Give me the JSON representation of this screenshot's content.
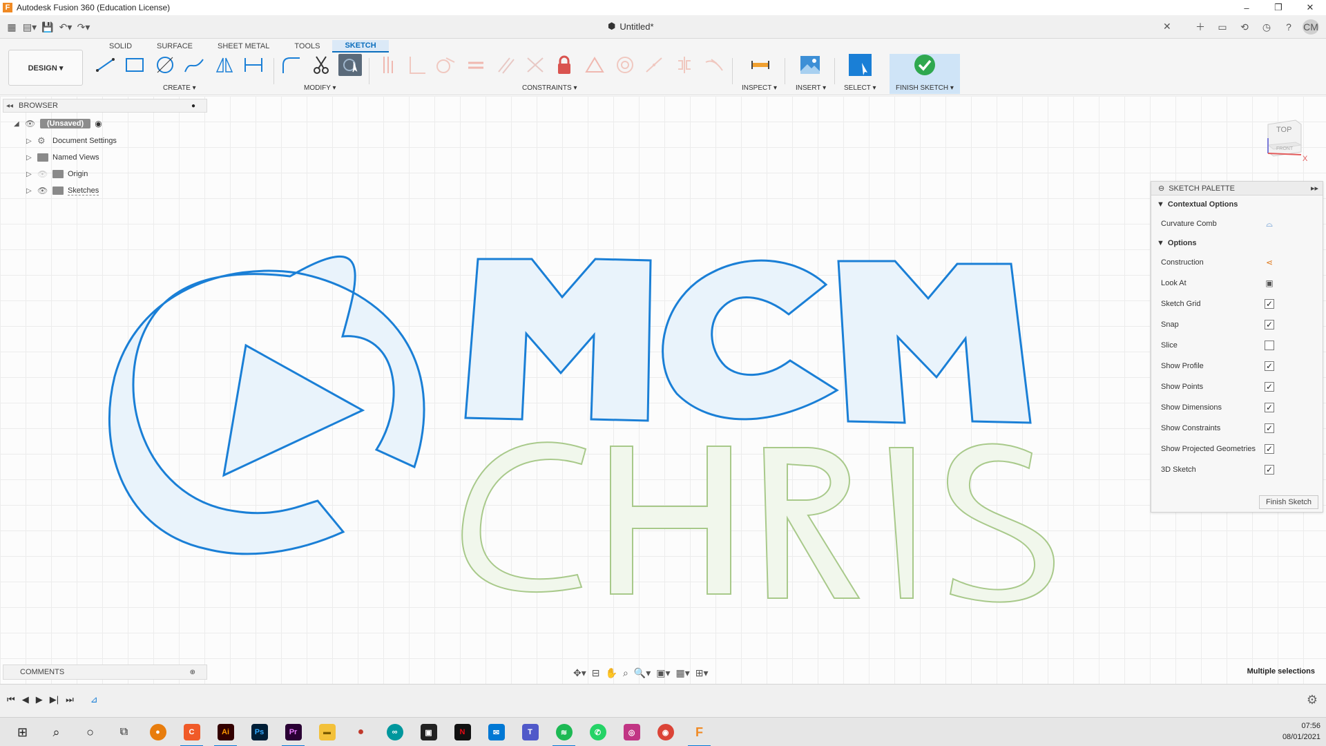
{
  "window": {
    "title": "Autodesk Fusion 360 (Education License)",
    "app_icon_letter": "F",
    "minimize": "–",
    "restore": "❐",
    "close": "✕"
  },
  "document": {
    "tab_title": "Untitled*",
    "close": "✕",
    "avatar": "CM"
  },
  "ribbon": {
    "workspace": "DESIGN ▾",
    "tabs": [
      "SOLID",
      "SURFACE",
      "SHEET METAL",
      "TOOLS",
      "SKETCH"
    ],
    "active_tab": "SKETCH",
    "groups": {
      "create": "CREATE ▾",
      "modify": "MODIFY ▾",
      "constraints": "CONSTRAINTS ▾",
      "inspect": "INSPECT ▾",
      "insert": "INSERT ▾",
      "select": "SELECT ▾",
      "finish": "FINISH SKETCH ▾"
    }
  },
  "browser": {
    "title": "BROWSER",
    "root": "(Unsaved)",
    "items": [
      "Document Settings",
      "Named Views",
      "Origin",
      "Sketches"
    ]
  },
  "viewcube": {
    "top": "TOP",
    "front": "FRONT",
    "axis_x": "X"
  },
  "palette": {
    "title": "SKETCH PALETTE",
    "contextual_section": "Contextual Options",
    "curvature_comb": "Curvature Comb",
    "options_section": "Options",
    "options": [
      {
        "label": "Construction",
        "type": "icon"
      },
      {
        "label": "Look At",
        "type": "icon"
      },
      {
        "label": "Sketch Grid",
        "checked": true
      },
      {
        "label": "Snap",
        "checked": true
      },
      {
        "label": "Slice",
        "checked": false
      },
      {
        "label": "Show Profile",
        "checked": true
      },
      {
        "label": "Show Points",
        "checked": true
      },
      {
        "label": "Show Dimensions",
        "checked": true
      },
      {
        "label": "Show Constraints",
        "checked": true
      },
      {
        "label": "Show Projected Geometries",
        "checked": true
      },
      {
        "label": "3D Sketch",
        "checked": true
      }
    ],
    "finish_button": "Finish Sketch"
  },
  "comments": {
    "label": "COMMENTS"
  },
  "status": {
    "selection": "Multiple selections"
  },
  "sketch_text": {
    "line1": "MCM",
    "line2": "CHRIS"
  },
  "colors": {
    "accent": "#0a6ebd",
    "sketch_blue": "#1a7fd6",
    "sketch_green": "#a8c98a",
    "fill": "#e9f3fb"
  },
  "clock": {
    "time": "07:56",
    "date": "08/01/2021"
  }
}
